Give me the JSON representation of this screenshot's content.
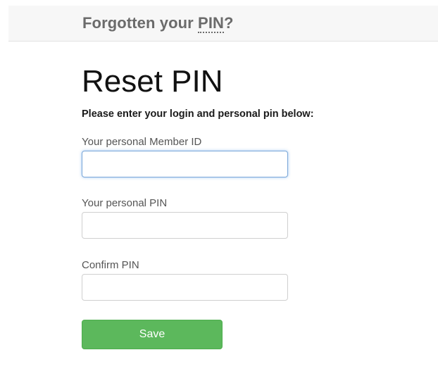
{
  "header": {
    "title_prefix": "Forgotten your ",
    "title_abbr": "PIN",
    "title_suffix": "?"
  },
  "main": {
    "title": "Reset PIN",
    "instructions": "Please enter your login and personal pin below:",
    "fields": [
      {
        "label": "Your personal Member ID",
        "value": "",
        "placeholder": ""
      },
      {
        "label": "Your personal PIN",
        "value": "",
        "placeholder": ""
      },
      {
        "label": "Confirm PIN",
        "value": "",
        "placeholder": ""
      }
    ],
    "save_label": "Save"
  },
  "colors": {
    "save_button": "#5cb85c",
    "focus_ring": "#7aa7d8",
    "header_bg": "#f7f7f7"
  }
}
